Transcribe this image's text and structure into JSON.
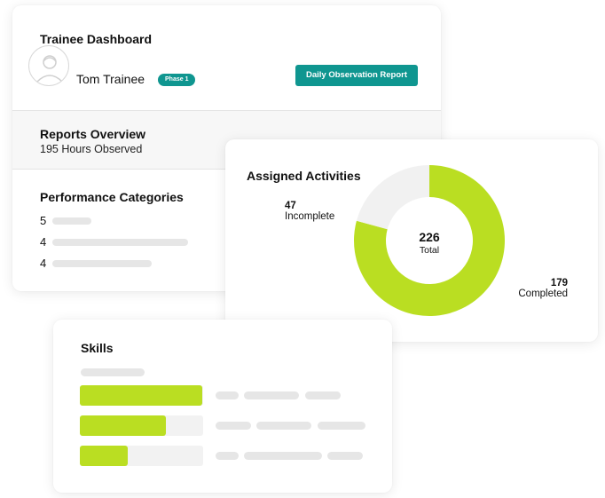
{
  "dashboard": {
    "title": "Trainee Dashboard",
    "trainee_name": "Tom Trainee",
    "phase_badge": "Phase 1",
    "report_button": "Daily Observation Report",
    "avatar_icon": "user-avatar-icon",
    "overview": {
      "title": "Reports Overview",
      "subtitle": "195 Hours Observed"
    },
    "performance": {
      "title": "Performance Categories",
      "items": [
        {
          "value": "5"
        },
        {
          "value": "4"
        },
        {
          "value": "4"
        }
      ]
    }
  },
  "activities": {
    "title": "Assigned Activities",
    "total_value": "226",
    "total_label": "Total",
    "incomplete": {
      "value": "47",
      "label": "Incomplete"
    },
    "completed": {
      "value": "179",
      "label": "Completed"
    }
  },
  "chart_data": {
    "type": "pie",
    "title": "Assigned Activities",
    "categories": [
      "Incomplete",
      "Completed"
    ],
    "values": [
      47,
      179
    ],
    "colors": [
      "#f1f1f1",
      "#bade22"
    ]
  },
  "skills": {
    "title": "Skills",
    "progress": [
      0.99,
      0.7,
      0.39
    ]
  },
  "colors": {
    "accent_teal": "#0f9690",
    "accent_lime": "#bade22",
    "placeholder_gray": "#e6e6e6"
  }
}
